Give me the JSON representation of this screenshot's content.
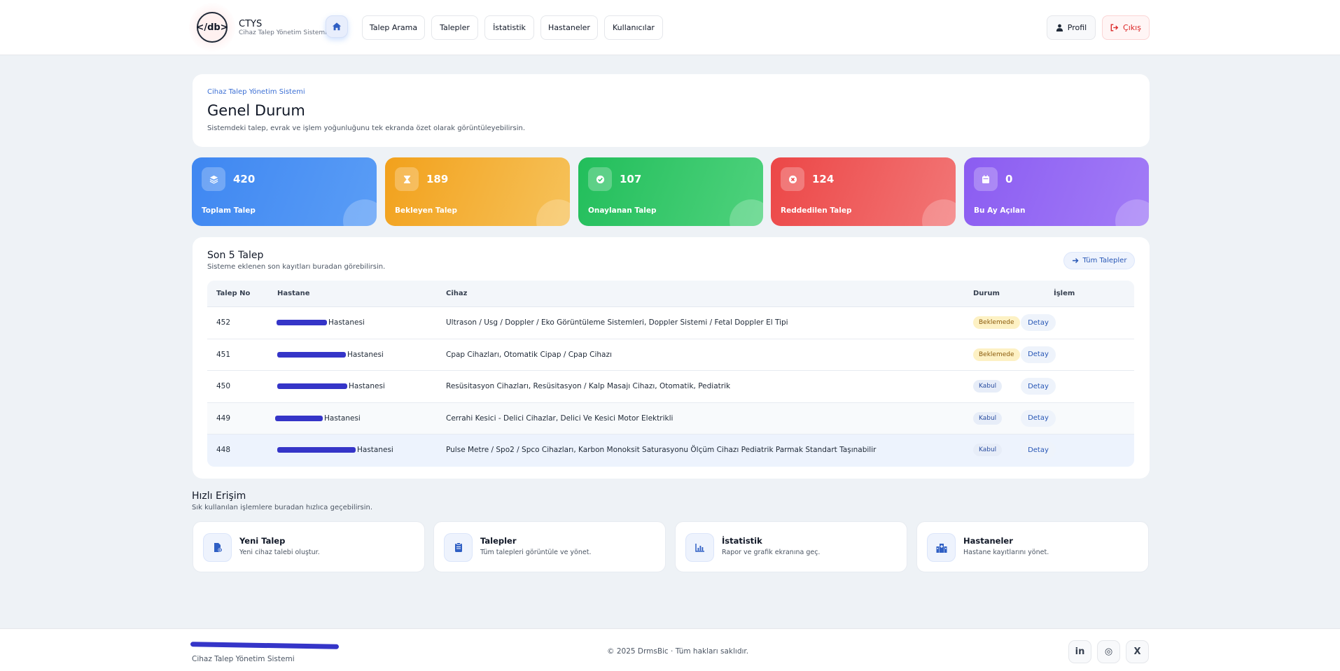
{
  "brand": {
    "logo_text": "</db>",
    "title": "CTYS",
    "subtitle": "Cihaz Talep Yönetim Sistemi"
  },
  "nav": {
    "home_icon": "home-icon",
    "items": [
      "Talep Arama",
      "Talepler",
      "İstatistik",
      "Hastaneler",
      "Kullanıcılar"
    ],
    "profile_label": "Profil",
    "logout_label": "Çıkış"
  },
  "hero": {
    "eyebrow": "Cihaz Talep Yönetim Sistemi",
    "title": "Genel Durum",
    "subtitle": "Sistemdeki talep, evrak ve işlem yoğunluğunu tek ekranda özet olarak görüntüleyebilirsin."
  },
  "stats": [
    {
      "value": "420",
      "label": "Toplam Talep",
      "icon": "layers-icon",
      "color": "#3f87f1"
    },
    {
      "value": "189",
      "label": "Bekleyen Talep",
      "icon": "hourglass-icon",
      "color": "#f2a11c"
    },
    {
      "value": "107",
      "label": "Onaylanan Talep",
      "icon": "check-circle-icon",
      "color": "#22be5b"
    },
    {
      "value": "124",
      "label": "Reddedilen Talep",
      "icon": "x-circle-icon",
      "color": "#ec4747"
    },
    {
      "value": "0",
      "label": "Bu Ay Açılan",
      "icon": "calendar-icon",
      "color": "#8b5cf1"
    }
  ],
  "recent": {
    "title": "Son 5 Talep",
    "subtitle": "Sisteme eklenen son kayıtları buradan görebilirsin.",
    "all_button": "Tüm Talepler",
    "columns": [
      "Talep No",
      "Hastane",
      "Cihaz",
      "Durum",
      "İşlem"
    ],
    "rows": [
      {
        "no": "452",
        "hospital": "Hastanesi",
        "device": "Ultrason / Usg / Doppler / Eko Görüntüleme Sistemleri, Doppler Sistemi / Fetal Doppler El Tipi",
        "status": "Beklemede",
        "action": "Detay"
      },
      {
        "no": "451",
        "hospital": "Hastanesi",
        "device": "Cpap Cihazları, Otomatik Cipap / Cpap Cihazı",
        "status": "Beklemede",
        "action": "Detay"
      },
      {
        "no": "450",
        "hospital": "Hastanesi",
        "device": "Resüsitasyon Cihazları, Resüsitasyon / Kalp Masajı Cihazı, Otomatik, Pediatrik",
        "status": "Kabul",
        "action": "Detay"
      },
      {
        "no": "449",
        "hospital": "Hastanesi",
        "device": "Cerrahi Kesici - Delici Cihazlar, Delici Ve Kesici Motor Elektrikli",
        "status": "Kabul",
        "action": "Detay"
      },
      {
        "no": "448",
        "hospital": "Hastanesi",
        "device": "Pulse Metre / Spo2 / Spco Cihazları, Karbon Monoksit Saturasyonu Ölçüm Cihazı Pediatrik Parmak Standart Taşınabilir",
        "status": "Kabul",
        "action": "Detay"
      }
    ]
  },
  "quick": {
    "title": "Hızlı Erişim",
    "subtitle": "Sık kullanılan işlemlere buradan hızlıca geçebilirsin.",
    "cards": [
      {
        "title": "Yeni Talep",
        "desc": "Yeni cihaz talebi oluştur.",
        "icon": "file-plus-icon"
      },
      {
        "title": "Talepler",
        "desc": "Tüm talepleri görüntüle ve yönet.",
        "icon": "clipboard-icon"
      },
      {
        "title": "İstatistik",
        "desc": "Rapor ve grafik ekranına geç.",
        "icon": "chart-icon"
      },
      {
        "title": "Hastaneler",
        "desc": "Hastane kayıtlarını yönet.",
        "icon": "hospital-icon"
      }
    ]
  },
  "footer": {
    "org": "",
    "system": "Cihaz Talep Yönetim Sistemi",
    "copyright": "© 2025 DrmsBic · Tüm hakları saklıdır.",
    "social": [
      {
        "label": "in",
        "icon": "linkedin-icon"
      },
      {
        "label": "◎",
        "icon": "instagram-icon"
      },
      {
        "label": "X",
        "icon": "x-icon"
      }
    ]
  },
  "colors": {
    "accent": "#2756b5",
    "page_bg": "#eef2f6",
    "danger": "#dc2626",
    "pending_badge": "#fdf1c4",
    "accepted_badge": "#e7edf8"
  }
}
